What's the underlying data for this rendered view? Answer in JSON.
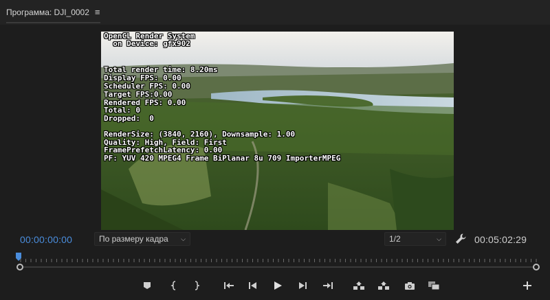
{
  "panel": {
    "title": "Программа: DJI_0002",
    "menu_icon": "hamburger-menu-icon"
  },
  "overlay": {
    "lines": [
      "OpenCL Render System",
      "  on Device: gfx902",
      "",
      "Total render time: 8.20ms",
      "Display FPS: 0.00",
      "Scheduler FPS: 0.00",
      "Target FPS:0.00",
      "Rendered FPS: 0.00",
      "Total: 0",
      "Dropped:  0",
      "",
      "RenderSize: (3840, 2160), Downsample: 1.00",
      "Quality: High, Field: First",
      "FramePrefetchLatency: 0.00",
      "PF: YUV 420 MPEG4 Frame BiPlanar 8u 709 ImporterMPEG"
    ]
  },
  "controls": {
    "current_timecode": "00:00:00:00",
    "duration_timecode": "00:05:02:29",
    "fit_select": {
      "value": "По размеру кадра"
    },
    "resolution_select": {
      "value": "1/2"
    }
  },
  "timeline": {
    "playhead_position": 0,
    "zoom_range": [
      0,
      1
    ]
  },
  "colors": {
    "accent_timecode": "#4a8ddc",
    "background": "#1d1d1d",
    "panel_header": "#232323"
  },
  "transport_icons": [
    "add-marker-icon",
    "mark-in-icon",
    "mark-out-icon",
    "go-to-in-icon",
    "step-back-icon",
    "play-icon",
    "step-forward-icon",
    "go-to-out-icon",
    "lift-icon",
    "extract-icon",
    "export-frame-icon",
    "comparison-view-icon",
    "add-button-icon"
  ]
}
